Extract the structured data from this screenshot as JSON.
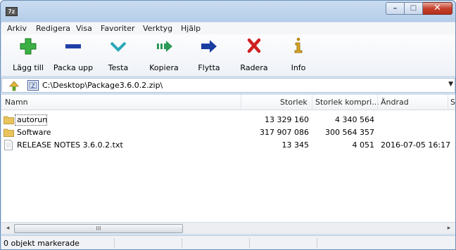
{
  "window": {
    "app_icon_text": "7z",
    "controls": {
      "minimize": "–",
      "maximize": "□",
      "close": "✕"
    }
  },
  "menu": [
    "Arkiv",
    "Redigera",
    "Visa",
    "Favoriter",
    "Verktyg",
    "Hjälp"
  ],
  "toolbar": {
    "buttons": [
      {
        "label": "Lägg till",
        "icon": "add-icon",
        "color": "#3cb043"
      },
      {
        "label": "Packa upp",
        "icon": "extract-icon",
        "color": "#1f3fa8"
      },
      {
        "label": "Testa",
        "icon": "test-checkmark-icon",
        "color": "#2aa7b8"
      },
      {
        "label": "Kopiera",
        "icon": "copy-arrow-icon",
        "color": "#2a9a55"
      },
      {
        "label": "Flytta",
        "icon": "move-arrow-icon",
        "color": "#1a3da0"
      },
      {
        "label": "Radera",
        "icon": "delete-x-icon",
        "color": "#d02020"
      },
      {
        "label": "Info",
        "icon": "info-icon",
        "color": "#b8860b"
      }
    ]
  },
  "address": {
    "path": "C:\\Desktop\\Package3.6.0.2.zip\\",
    "dropdown": "▼"
  },
  "list": {
    "columns": [
      "Namn",
      "Storlek",
      "Storlek kompri...",
      "Ändrad",
      "S"
    ],
    "rows": [
      {
        "name": "autorun",
        "type": "folder",
        "size": "13 329 160",
        "packed": "4 340 564",
        "modified": ""
      },
      {
        "name": "Software",
        "type": "folder",
        "size": "317 907 086",
        "packed": "300 564 357",
        "modified": ""
      },
      {
        "name": "RELEASE NOTES 3.6.0.2.txt",
        "type": "file",
        "size": "13 345",
        "packed": "4 051",
        "modified": "2016-07-05 16:17"
      }
    ]
  },
  "scrollbar": {
    "left": "◂",
    "right": "▸",
    "grip": "III"
  },
  "status": {
    "text": "0 objekt markerade"
  }
}
